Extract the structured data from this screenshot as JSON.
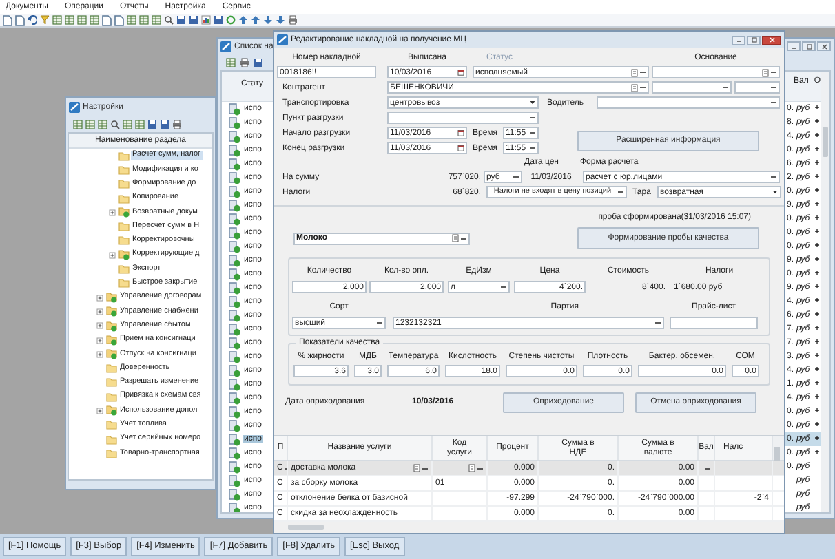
{
  "menu": [
    "Документы",
    "Операции",
    "Отчеты",
    "Настройка",
    "Сервис"
  ],
  "settings_window": {
    "title": "Настройки",
    "column": "Наименование раздела",
    "tree": [
      {
        "children": [
          {
            "label": "Расчет сумм, налог",
            "expandable": false,
            "selected": true
          },
          {
            "label": "Модификация и ко",
            "expandable": false,
            "selected": false
          },
          {
            "label": "Формирование до",
            "expandable": false,
            "selected": false
          },
          {
            "label": "Копирование",
            "expandable": false,
            "selected": false
          },
          {
            "label": "Возвратные докум",
            "expandable": true,
            "selected": false
          },
          {
            "label": "Пересчет сумм в Н",
            "expandable": false,
            "selected": false
          },
          {
            "label": "Корректировочны",
            "expandable": false,
            "selected": false
          },
          {
            "label": "Корректирующие д",
            "expandable": true,
            "selected": false
          },
          {
            "label": "Экспорт",
            "expandable": false,
            "selected": false
          },
          {
            "label": "Быстрое закрытие",
            "expandable": false,
            "selected": false
          }
        ]
      },
      {
        "label": "Управление договорам",
        "expandable": true,
        "selected": false
      },
      {
        "label": "Управление снабжени",
        "expandable": true,
        "selected": false
      },
      {
        "label": "Управление сбытом",
        "expandable": true,
        "selected": false
      },
      {
        "label": "Прием на консигнаци",
        "expandable": true,
        "selected": false
      },
      {
        "label": "Отпуск на консигнаци",
        "expandable": true,
        "selected": false
      },
      {
        "label": "Доверенность",
        "expandable": false,
        "selected": false
      },
      {
        "label": "Разрешать изменение",
        "expandable": false,
        "selected": false
      },
      {
        "label": "Привязка к схемам свя",
        "expandable": false,
        "selected": false
      },
      {
        "label": "Использование допол",
        "expandable": true,
        "selected": false
      },
      {
        "label": "Учет топлива",
        "expandable": false,
        "selected": false
      },
      {
        "label": "Учет серийных номеро",
        "expandable": false,
        "selected": false
      },
      {
        "label": "Товарно-транспортная",
        "expandable": false,
        "selected": false
      }
    ]
  },
  "list_window": {
    "title": "Список на",
    "columns": [
      "Стату",
      "Вал",
      "О"
    ],
    "rows": [
      {
        "status": "испо",
        "amount": "0.",
        "currency": "руб",
        "flag": "+",
        "selected": false
      },
      {
        "status": "испо",
        "amount": "8.",
        "currency": "руб",
        "flag": "+",
        "selected": false
      },
      {
        "status": "испо",
        "amount": "4.",
        "currency": "руб",
        "flag": "+",
        "selected": false
      },
      {
        "status": "испо",
        "amount": "0.",
        "currency": "руб",
        "flag": "+",
        "selected": false
      },
      {
        "status": "испо",
        "amount": "6.",
        "currency": "руб",
        "flag": "+",
        "selected": false
      },
      {
        "status": "испо",
        "amount": "2.",
        "currency": "руб",
        "flag": "+",
        "selected": false
      },
      {
        "status": "испо",
        "amount": "0.",
        "currency": "руб",
        "flag": "+",
        "selected": false
      },
      {
        "status": "испо",
        "amount": "9.",
        "currency": "руб",
        "flag": "+",
        "selected": false
      },
      {
        "status": "испо",
        "amount": "0.",
        "currency": "руб",
        "flag": "+",
        "selected": false
      },
      {
        "status": "испо",
        "amount": "0.",
        "currency": "руб",
        "flag": "+",
        "selected": false
      },
      {
        "status": "испо",
        "amount": "0.",
        "currency": "руб",
        "flag": "+",
        "selected": false
      },
      {
        "status": "испо",
        "amount": "9.",
        "currency": "руб",
        "flag": "+",
        "selected": false
      },
      {
        "status": "испо",
        "amount": "0.",
        "currency": "руб",
        "flag": "+",
        "selected": false
      },
      {
        "status": "испо",
        "amount": "9.",
        "currency": "руб",
        "flag": "+",
        "selected": false
      },
      {
        "status": "испо",
        "amount": "4.",
        "currency": "руб",
        "flag": "+",
        "selected": false
      },
      {
        "status": "испо",
        "amount": "6.",
        "currency": "руб",
        "flag": "+",
        "selected": false
      },
      {
        "status": "испо",
        "amount": "7.",
        "currency": "руб",
        "flag": "+",
        "selected": false
      },
      {
        "status": "испо",
        "amount": "7.",
        "currency": "руб",
        "flag": "+",
        "selected": false
      },
      {
        "status": "испо",
        "amount": "3.",
        "currency": "руб",
        "flag": "+",
        "selected": false
      },
      {
        "status": "испо",
        "amount": "4.",
        "currency": "руб",
        "flag": "+",
        "selected": false
      },
      {
        "status": "испо",
        "amount": "1.",
        "currency": "руб",
        "flag": "+",
        "selected": false
      },
      {
        "status": "испо",
        "amount": "4.",
        "currency": "руб",
        "flag": "+",
        "selected": false
      },
      {
        "status": "испо",
        "amount": "0.",
        "currency": "руб",
        "flag": "+",
        "selected": false
      },
      {
        "status": "испо",
        "amount": "0.",
        "currency": "руб",
        "flag": "+",
        "selected": false
      },
      {
        "status": "испо",
        "amount": "0.",
        "currency": "руб",
        "flag": "+",
        "selected": true
      },
      {
        "status": "испо",
        "amount": "0.",
        "currency": "руб",
        "flag": "+",
        "selected": false
      },
      {
        "status": "испо",
        "amount": "0.",
        "currency": "руб",
        "selected": false
      },
      {
        "status": "испо",
        "currency": "руб",
        "selected": false
      },
      {
        "status": "испо",
        "currency": "руб",
        "selected": false
      },
      {
        "status": "испо",
        "currency": "руб",
        "selected": false
      }
    ]
  },
  "invoice": {
    "title": "Редактирование накладной на получение МЦ",
    "number": {
      "label": "Номер накладной",
      "value": "0018186!!"
    },
    "issued": {
      "label": "Выписана",
      "value": "10/03/2016"
    },
    "status": {
      "label": "Статус",
      "value": "исполняемый"
    },
    "basis": {
      "label": "Основание"
    },
    "counterparty": {
      "label": "Контрагент",
      "value": "БЕШЕНКОВИЧИ"
    },
    "transport": {
      "label": "Транспортировка",
      "value": "центровывоз"
    },
    "driver": {
      "label": "Водитель"
    },
    "unload_point": {
      "label": "Пункт разгрузки"
    },
    "unload_start": {
      "label": "Начало разгрузки",
      "date": "11/03/2016",
      "time_label": "Время",
      "time": "11:55"
    },
    "unload_end": {
      "label": "Конец разгрузки",
      "date": "11/03/2016",
      "time_label": "Время",
      "time": "11:55"
    },
    "extended_button": "Расширенная информация",
    "price_date_label": "Дата цен",
    "payment_form_label": "Форма расчета",
    "amount": {
      "label": "На сумму",
      "value": "757`020.",
      "currency": "руб",
      "price_date": "11/03/2016",
      "payment_form": "расчет с юр.лицами"
    },
    "taxes": {
      "label": "Налоги",
      "value": "68`820.",
      "mode": "Налоги не входят в цену позиций",
      "tare_label": "Тара",
      "tare": "возвратная"
    },
    "sample_note": "проба сформирована(31/03/2016 15:07)",
    "product": "Молоко",
    "sample_button": "Формирование пробы качества",
    "position": {
      "quantity": {
        "label": "Количество",
        "value": "2.000"
      },
      "paid_quantity": {
        "label": "Кол-во опл.",
        "value": "2.000"
      },
      "unit": {
        "label": "ЕдИзм",
        "value": "л"
      },
      "price": {
        "label": "Цена",
        "value": "4`200."
      },
      "cost": {
        "label": "Стоимость",
        "value": "8`400."
      },
      "taxes": {
        "label": "Налоги",
        "value": "1`680.00 руб"
      },
      "grade": {
        "label": "Сорт",
        "value": "высший"
      },
      "batch": {
        "label": "Партия",
        "value": "1232132321"
      },
      "price_list": {
        "label": "Прайс-лист"
      }
    },
    "quality": {
      "title": "Показатели качества",
      "fields": [
        {
          "label": "% жирности",
          "value": "3.6"
        },
        {
          "label": "МДБ",
          "value": "3.0"
        },
        {
          "label": "Температура",
          "value": "6.0"
        },
        {
          "label": "Кислотность",
          "value": "18.0"
        },
        {
          "label": "Степень чистоты",
          "value": "0.0"
        },
        {
          "label": "Плотность",
          "value": "0.0"
        },
        {
          "label": "Бактер. обсемен.",
          "value": "0.0"
        },
        {
          "label": "СОМ",
          "value": "0.0"
        }
      ]
    },
    "posting": {
      "label": "Дата оприходования",
      "date": "10/03/2016",
      "buttons": [
        "Оприходование",
        "Отмена оприходования"
      ]
    },
    "services": {
      "columns": [
        "П",
        "Название услуги",
        "Код услуги",
        "Процент",
        "Сумма в НДЕ",
        "Сумма в валюте",
        "Вал",
        "Налс"
      ],
      "rows": [
        {
          "type": "С",
          "name": "доставка молока",
          "percent": "0.000",
          "sum_base": "0.",
          "sum_currency": "0.00",
          "selected": true
        },
        {
          "type": "С",
          "name": "за сборку молока",
          "code": "01",
          "percent": "0.000",
          "sum_base": "0.",
          "sum_currency": "0.00",
          "selected": false
        },
        {
          "type": "С",
          "name": "отклонение белка от базисной",
          "percent": "-97.299",
          "sum_base": "-24`790`000.",
          "sum_currency": "-24`790`000.00",
          "tax": "-2`4",
          "selected": false
        },
        {
          "type": "С",
          "name": "скидка за неохлажденность",
          "percent": "0.000",
          "sum_base": "0.",
          "sum_currency": "0.00",
          "selected": false
        }
      ]
    }
  },
  "function_keys": [
    "[F1] Помощь",
    "[F3] Выбор",
    "[F4] Изменить",
    "[F7] Добавить",
    "[F8] Удалить",
    "[Esc] Выход"
  ]
}
